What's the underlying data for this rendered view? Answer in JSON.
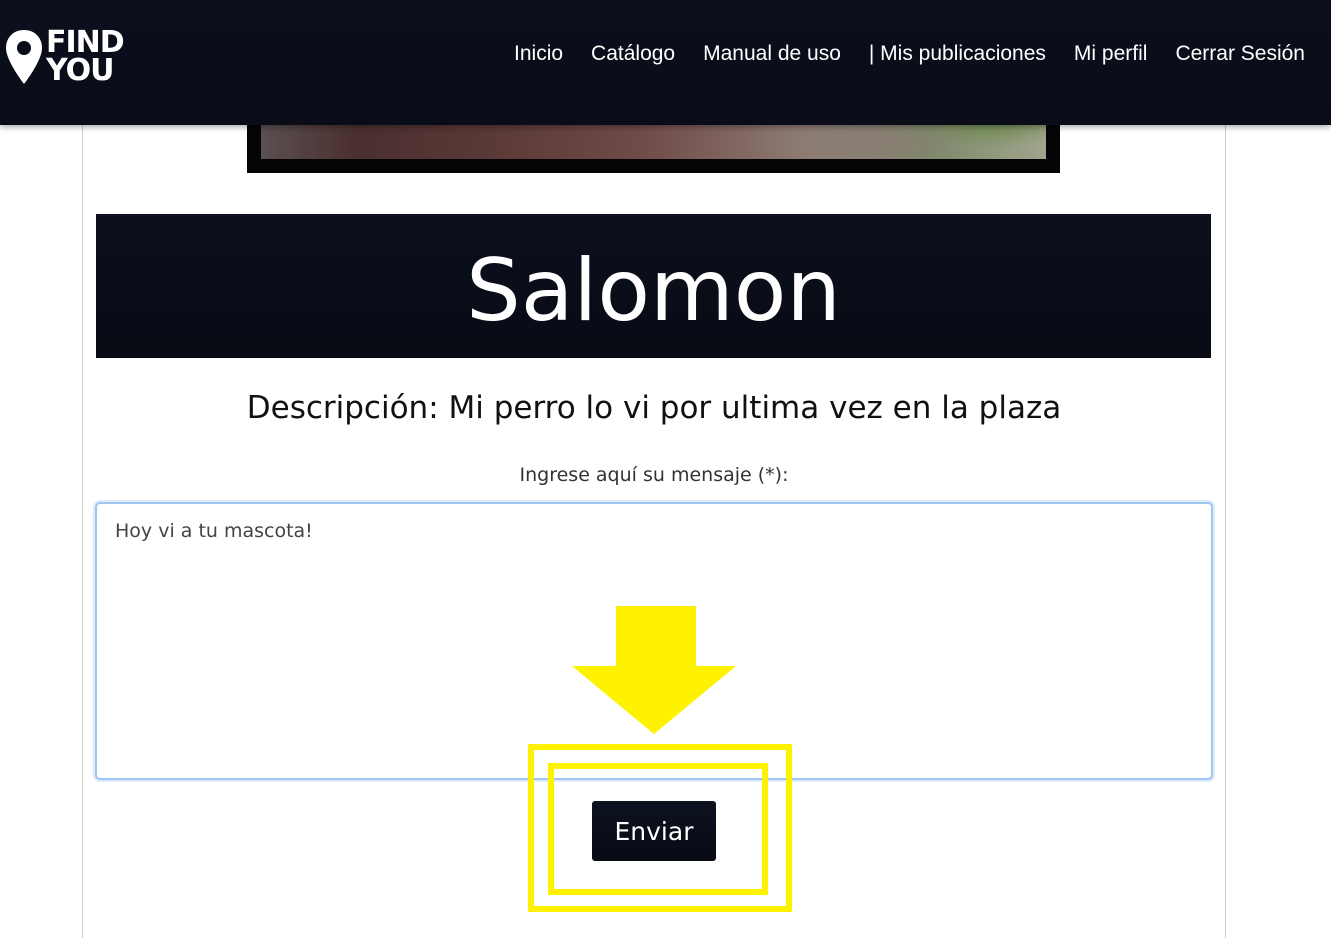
{
  "navbar": {
    "logo_line1": "FIND",
    "logo_line2": "YOU",
    "links": [
      "Inicio",
      "Catálogo",
      "Manual de uso",
      "| Mis publicaciones",
      "Mi perfil",
      "Cerrar Sesión"
    ]
  },
  "pet": {
    "name": "Salomon",
    "description": "Descripción: Mi perro lo vi por ultima vez en la plaza"
  },
  "message_form": {
    "label": "Ingrese aquí su mensaje (*):",
    "value": "Hoy vi a tu mascota!",
    "submit_label": "Enviar"
  },
  "colors": {
    "navbar_bg": "#0a0d17",
    "highlight": "#fff200",
    "input_focus": "#9ec5f3"
  },
  "icons": [
    "location-pin-icon",
    "down-arrow-icon"
  ]
}
